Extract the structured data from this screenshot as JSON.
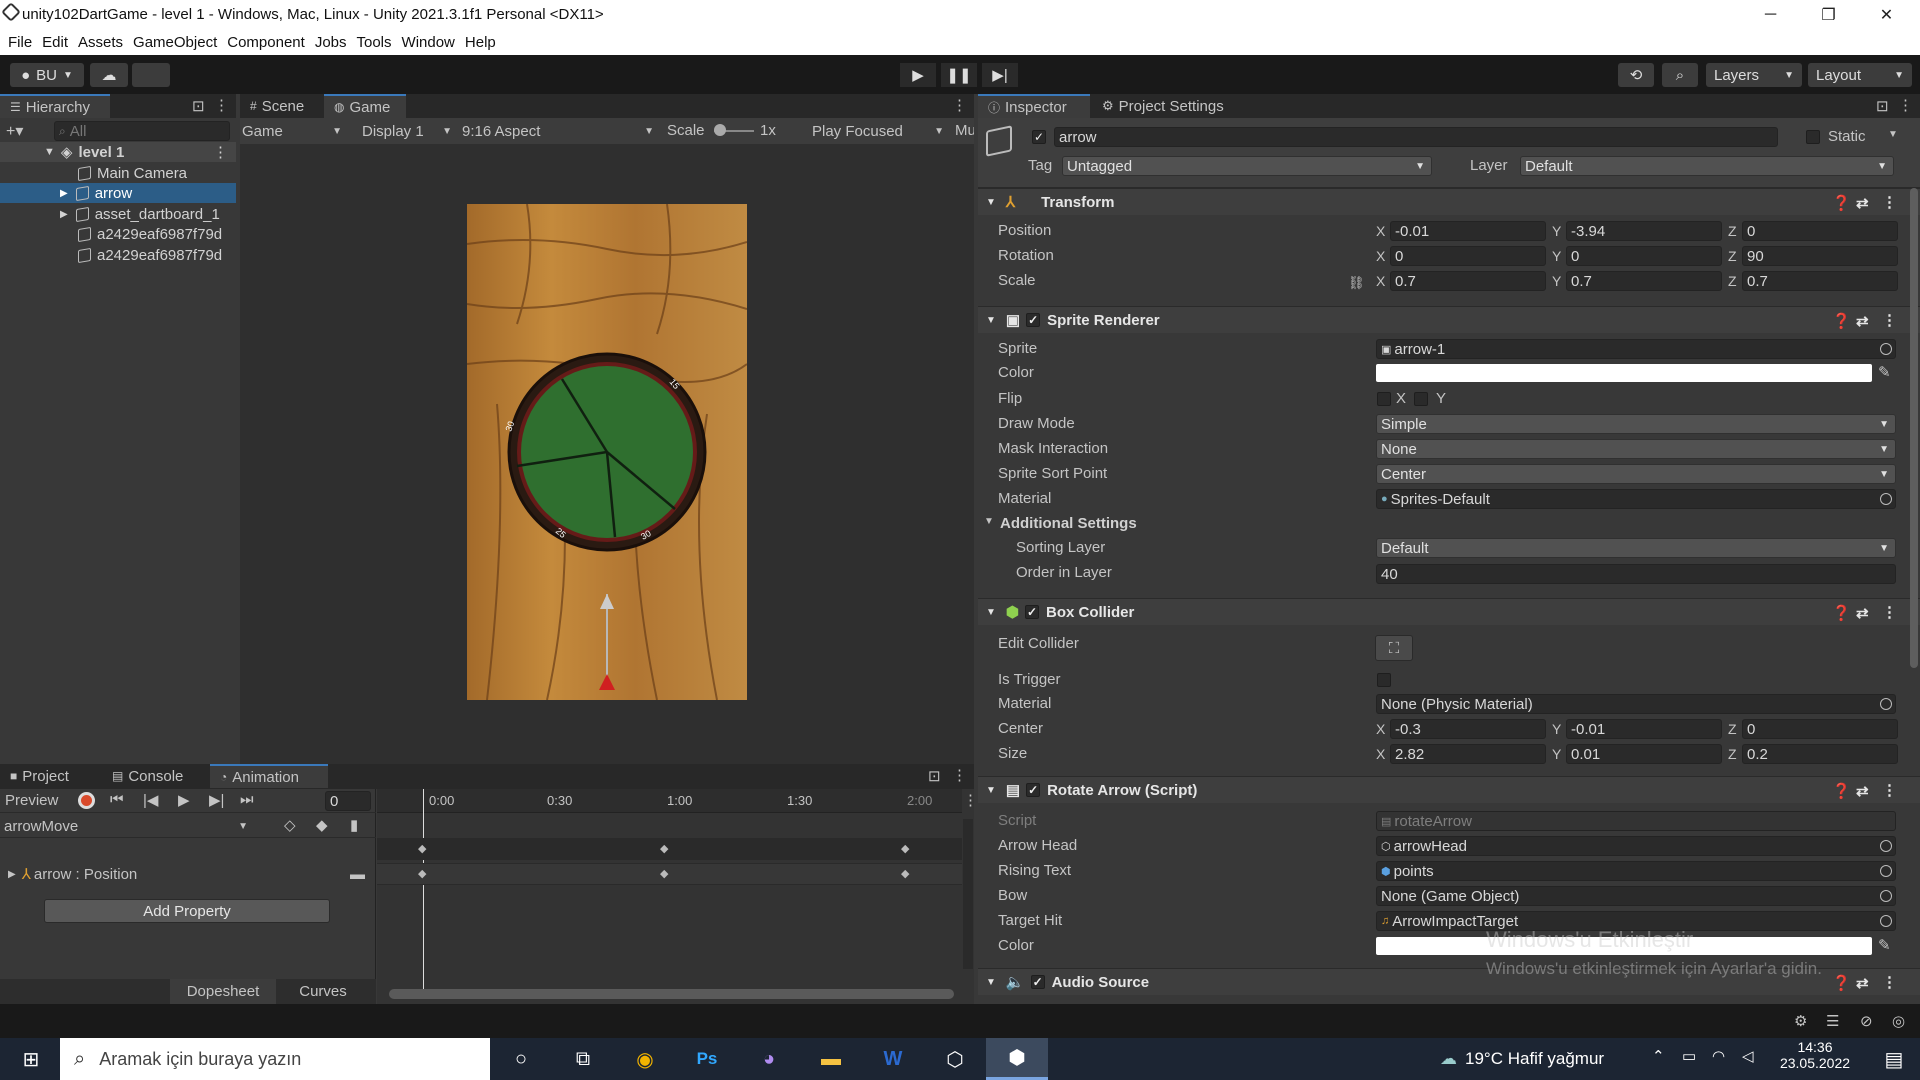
{
  "window": {
    "title": "unity102DartGame - level 1 - Windows, Mac, Linux - Unity 2021.3.1f1 Personal <DX11>",
    "controls": {
      "minimize": "─",
      "maximize": "❐",
      "close": "✕"
    }
  },
  "menu": [
    "File",
    "Edit",
    "Assets",
    "GameObject",
    "Component",
    "Jobs",
    "Tools",
    "Window",
    "Help"
  ],
  "toolbar": {
    "account": "BU",
    "layers": "Layers",
    "layout": "Layout"
  },
  "hierarchy": {
    "tab": "Hierarchy",
    "search_placeholder": "All",
    "scene": "level 1",
    "items": [
      "Main Camera",
      "arrow",
      "asset_dartboard_1",
      "a2429eaf6987f79d",
      "a2429eaf6987f79d"
    ]
  },
  "view": {
    "tabs": [
      "Scene",
      "Game"
    ],
    "game_dropdown": "Game",
    "display": "Display 1",
    "aspect": "9:16 Aspect",
    "scale_label": "Scale",
    "scale_value": "1x",
    "play_focused": "Play Focused",
    "mute": "Mu"
  },
  "game": {
    "board_labels": [
      "15",
      "30",
      "25",
      "30"
    ]
  },
  "bottom": {
    "tabs": [
      "Project",
      "Console",
      "Animation"
    ],
    "preview": "Preview",
    "frame": "0",
    "clip": "arrowMove",
    "track": "arrow : Position",
    "add_property": "Add Property",
    "timeline_ticks": [
      "0:00",
      "0:30",
      "1:00",
      "1:30",
      "2:00"
    ],
    "dopesheet": "Dopesheet",
    "curves": "Curves"
  },
  "inspector": {
    "tabs": [
      "Inspector",
      "Project Settings"
    ],
    "object_name": "arrow",
    "static_label": "Static",
    "tag_label": "Tag",
    "tag": "Untagged",
    "layer_label": "Layer",
    "layer": "Default",
    "transform": {
      "title": "Transform",
      "rows": [
        {
          "label": "Position",
          "x": "-0.01",
          "y": "-3.94",
          "z": "0"
        },
        {
          "label": "Rotation",
          "x": "0",
          "y": "0",
          "z": "90"
        },
        {
          "label": "Scale",
          "x": "0.7",
          "y": "0.7",
          "z": "0.7"
        }
      ]
    },
    "sprite_renderer": {
      "title": "Sprite Renderer",
      "sprite_label": "Sprite",
      "sprite": "arrow-1",
      "color_label": "Color",
      "flip_label": "Flip",
      "flip_x": "X",
      "flip_y": "Y",
      "draw_mode_label": "Draw Mode",
      "draw_mode": "Simple",
      "mask_label": "Mask Interaction",
      "mask": "None",
      "sort_point_label": "Sprite Sort Point",
      "sort_point": "Center",
      "material_label": "Material",
      "material": "Sprites-Default",
      "additional": "Additional Settings",
      "sorting_layer_label": "Sorting Layer",
      "sorting_layer": "Default",
      "order_label": "Order in Layer",
      "order": "40"
    },
    "box_collider": {
      "title": "Box Collider",
      "edit_label": "Edit Collider",
      "trigger_label": "Is Trigger",
      "material_label": "Material",
      "material": "None (Physic Material)",
      "center_label": "Center",
      "center": {
        "x": "-0.3",
        "y": "-0.01",
        "z": "0"
      },
      "size_label": "Size",
      "size": {
        "x": "2.82",
        "y": "0.01",
        "z": "0.2"
      }
    },
    "rotate_arrow": {
      "title": "Rotate Arrow (Script)",
      "script_label": "Script",
      "script": "rotateArrow",
      "arrow_head_label": "Arrow Head",
      "arrow_head": "arrowHead",
      "rising_label": "Rising Text",
      "rising": "points",
      "bow_label": "Bow",
      "bow": "None (Game Object)",
      "target_label": "Target Hit",
      "target": "ArrowImpactTarget",
      "color_label": "Color"
    },
    "audio_source": {
      "title": "Audio Source"
    }
  },
  "watermark": {
    "line1": "Windows'u Etkinleştir",
    "line2": "Windows'u etkinleştirmek için Ayarlar'a gidin."
  },
  "taskbar": {
    "search_placeholder": "Aramak için buraya yazın",
    "weather": "19°C  Hafif yağmur",
    "time": "14:36",
    "date": "23.05.2022"
  },
  "colors": {
    "selection": "#2c5d87",
    "accent": "#3a79bb"
  }
}
